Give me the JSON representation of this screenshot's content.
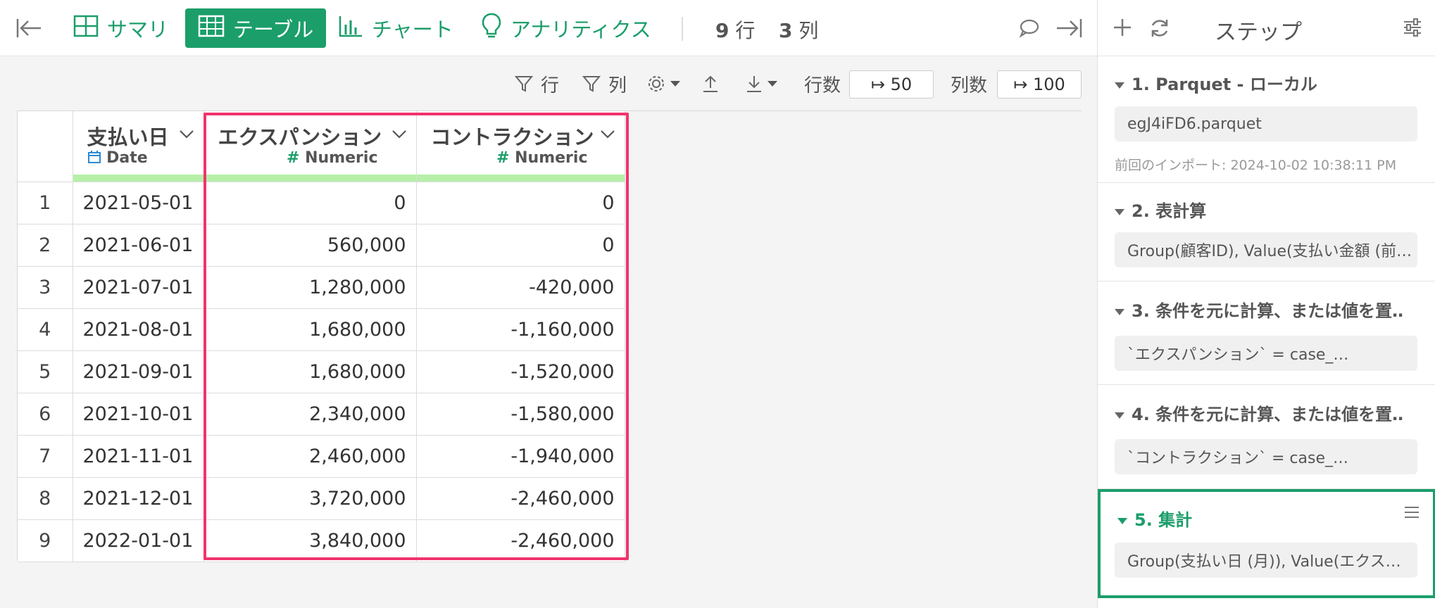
{
  "toolbar": {
    "summary": "サマリ",
    "table": "テーブル",
    "chart": "チャート",
    "analytics": "アナリティクス",
    "rows_count": "9",
    "rows_label": "行",
    "cols_count": "3",
    "cols_label": "列"
  },
  "subtoolbar": {
    "filter_rows": "行",
    "filter_cols": "列",
    "row_count_label": "行数",
    "row_count_value": "↦ 50",
    "col_count_label": "列数",
    "col_count_value": "↦ 100"
  },
  "table": {
    "columns": [
      {
        "name": "支払い日",
        "type": "Date"
      },
      {
        "name": "エクスパンション",
        "type": "Numeric"
      },
      {
        "name": "コントラクション",
        "type": "Numeric"
      }
    ],
    "rows": [
      {
        "n": "1",
        "date": "2021-05-01",
        "exp": "0",
        "con": "0"
      },
      {
        "n": "2",
        "date": "2021-06-01",
        "exp": "560,000",
        "con": "0"
      },
      {
        "n": "3",
        "date": "2021-07-01",
        "exp": "1,280,000",
        "con": "-420,000"
      },
      {
        "n": "4",
        "date": "2021-08-01",
        "exp": "1,680,000",
        "con": "-1,160,000"
      },
      {
        "n": "5",
        "date": "2021-09-01",
        "exp": "1,680,000",
        "con": "-1,520,000"
      },
      {
        "n": "6",
        "date": "2021-10-01",
        "exp": "2,340,000",
        "con": "-1,580,000"
      },
      {
        "n": "7",
        "date": "2021-11-01",
        "exp": "2,460,000",
        "con": "-1,940,000"
      },
      {
        "n": "8",
        "date": "2021-12-01",
        "exp": "3,720,000",
        "con": "-2,460,000"
      },
      {
        "n": "9",
        "date": "2022-01-01",
        "exp": "3,840,000",
        "con": "-2,460,000"
      }
    ]
  },
  "sidebar": {
    "title": "ステップ",
    "steps": [
      {
        "title": "1. Parquet - ローカル",
        "detail": "egJ4iFD6.parquet",
        "meta": "前回のインポート: 2024-10-02 10:38:11 PM"
      },
      {
        "title": "2. 表計算",
        "detail": "Group(顧客ID), Value(支払い金額 (前…"
      },
      {
        "title": "3. 条件を元に計算、または値を置…",
        "detail": "`エクスパンション` = case_…"
      },
      {
        "title": "4. 条件を元に計算、または値を置…",
        "detail": "`コントラクション` = case_…"
      },
      {
        "title": "5. 集計",
        "detail": "Group(支払い日 (月)), Value(エクス…"
      }
    ]
  },
  "colors": {
    "accent": "#1b9e6a",
    "highlight": "#f0346e",
    "type_bar": "#b6f0a8"
  }
}
